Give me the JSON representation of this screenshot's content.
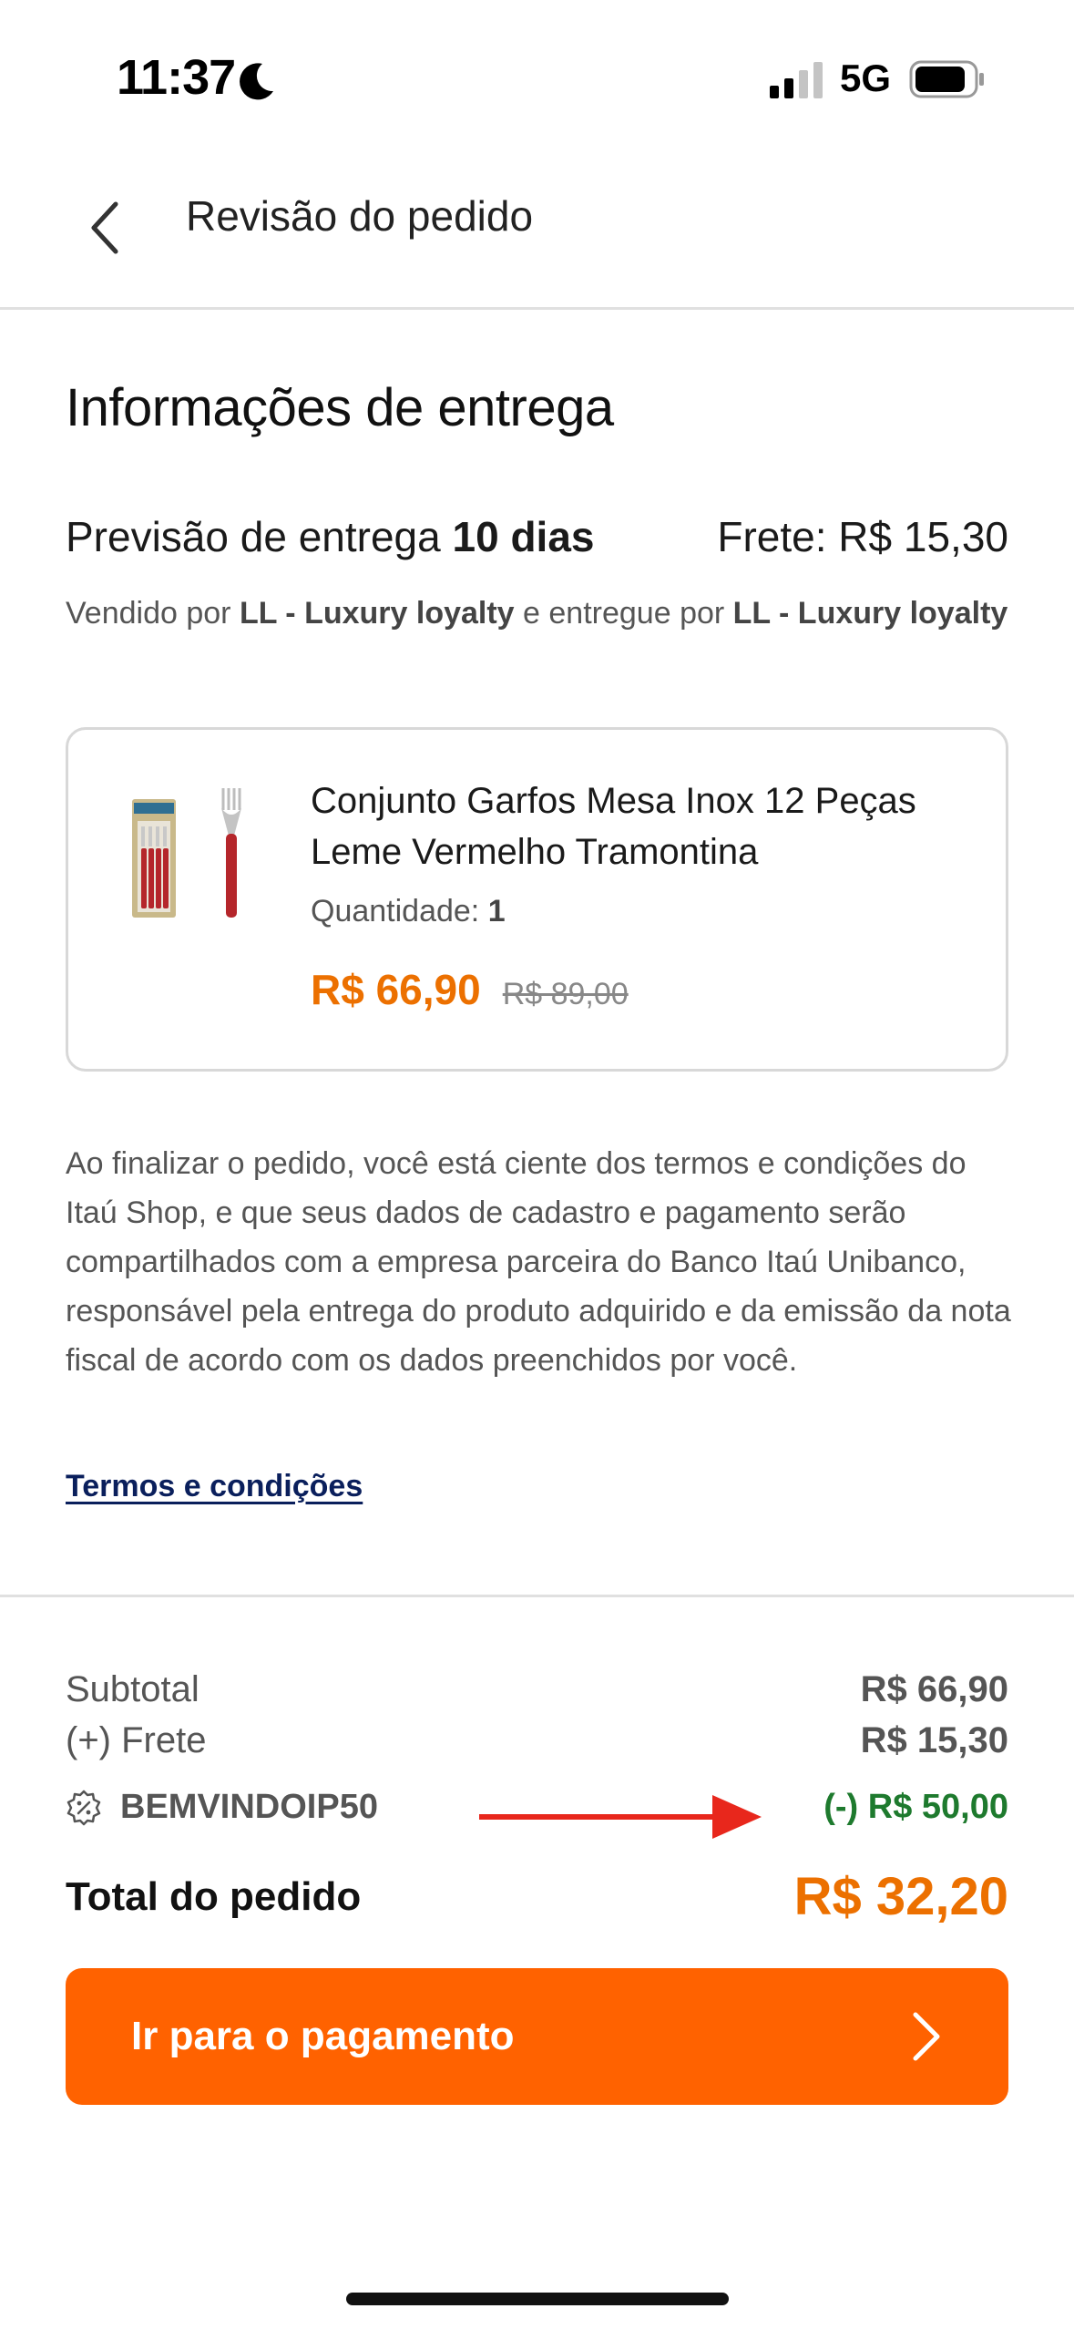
{
  "status_bar": {
    "time": "11:37",
    "network": "5G"
  },
  "header": {
    "title": "Revisão do pedido"
  },
  "delivery": {
    "section_title": "Informações de entrega",
    "estimate_prefix": "Previsão de entrega ",
    "estimate_days": "10 dias",
    "shipping": "Frete: R$ 15,30",
    "sold_prefix": "Vendido por ",
    "seller": "LL - Luxury loyalty",
    "delivered_prefix": " e entregue por ",
    "deliverer": "LL - Luxury loyalty"
  },
  "product": {
    "name": "Conjunto Garfos Mesa Inox 12 Peças Leme Vermelho Tramontina",
    "qty_label": "Quantidade: ",
    "qty_value": "1",
    "price": "R$ 66,90",
    "old_price": "R$ 89,00"
  },
  "legal": {
    "text": "Ao finalizar o pedido, você está ciente dos termos e condições do Itaú Shop, e que seus dados de cadastro e pagamento serão compartilhados com a empresa parceira do Banco Itaú Unibanco, responsável pela entrega do produto adquirido e da emissão da nota fiscal de acordo com os dados preenchidos por você.",
    "terms_link": "Termos e condições"
  },
  "summary": {
    "subtotal_label": "Subtotal",
    "subtotal_value": "R$ 66,90",
    "frete_label": "(+) Frete",
    "frete_value": "R$ 15,30",
    "coupon_code": "BEMVINDOIP50",
    "coupon_value": "(-) R$ 50,00",
    "total_label": "Total do pedido",
    "total_value": "R$ 32,20"
  },
  "cta": {
    "label": "Ir para o pagamento"
  },
  "colors": {
    "accent": "#ff6200",
    "price": "#ec7000",
    "discount": "#1e7a2e",
    "link": "#0a1f5c",
    "annotation_arrow": "#e8271c"
  }
}
